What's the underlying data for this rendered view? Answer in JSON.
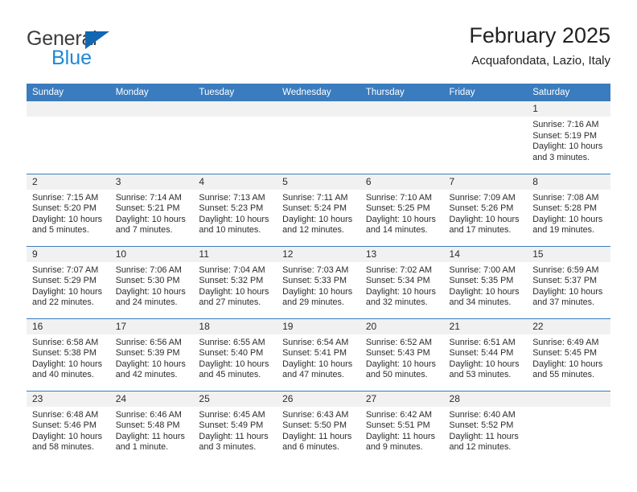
{
  "brand": {
    "line1": "General",
    "line2": "Blue",
    "triangle_color": "#1267b2"
  },
  "header": {
    "title": "February 2025",
    "subtitle": "Acquafondata, Lazio, Italy"
  },
  "theme": {
    "header_blue": "#3a7cbe",
    "daynum_band": "#f1f1f1",
    "text": "#2b2b2b"
  },
  "labels": {
    "sunrise_prefix": "Sunrise:",
    "sunset_prefix": "Sunset:",
    "daylight_prefix": "Daylight:"
  },
  "weekdays": [
    "Sunday",
    "Monday",
    "Tuesday",
    "Wednesday",
    "Thursday",
    "Friday",
    "Saturday"
  ],
  "weeks": [
    [
      {
        "day": "",
        "sunrise": "",
        "sunset": "",
        "daylight1": "",
        "daylight2": ""
      },
      {
        "day": "",
        "sunrise": "",
        "sunset": "",
        "daylight1": "",
        "daylight2": ""
      },
      {
        "day": "",
        "sunrise": "",
        "sunset": "",
        "daylight1": "",
        "daylight2": ""
      },
      {
        "day": "",
        "sunrise": "",
        "sunset": "",
        "daylight1": "",
        "daylight2": ""
      },
      {
        "day": "",
        "sunrise": "",
        "sunset": "",
        "daylight1": "",
        "daylight2": ""
      },
      {
        "day": "",
        "sunrise": "",
        "sunset": "",
        "daylight1": "",
        "daylight2": ""
      },
      {
        "day": "1",
        "sunrise": "Sunrise: 7:16 AM",
        "sunset": "Sunset: 5:19 PM",
        "daylight1": "Daylight: 10 hours",
        "daylight2": "and 3 minutes."
      }
    ],
    [
      {
        "day": "2",
        "sunrise": "Sunrise: 7:15 AM",
        "sunset": "Sunset: 5:20 PM",
        "daylight1": "Daylight: 10 hours",
        "daylight2": "and 5 minutes."
      },
      {
        "day": "3",
        "sunrise": "Sunrise: 7:14 AM",
        "sunset": "Sunset: 5:21 PM",
        "daylight1": "Daylight: 10 hours",
        "daylight2": "and 7 minutes."
      },
      {
        "day": "4",
        "sunrise": "Sunrise: 7:13 AM",
        "sunset": "Sunset: 5:23 PM",
        "daylight1": "Daylight: 10 hours",
        "daylight2": "and 10 minutes."
      },
      {
        "day": "5",
        "sunrise": "Sunrise: 7:11 AM",
        "sunset": "Sunset: 5:24 PM",
        "daylight1": "Daylight: 10 hours",
        "daylight2": "and 12 minutes."
      },
      {
        "day": "6",
        "sunrise": "Sunrise: 7:10 AM",
        "sunset": "Sunset: 5:25 PM",
        "daylight1": "Daylight: 10 hours",
        "daylight2": "and 14 minutes."
      },
      {
        "day": "7",
        "sunrise": "Sunrise: 7:09 AM",
        "sunset": "Sunset: 5:26 PM",
        "daylight1": "Daylight: 10 hours",
        "daylight2": "and 17 minutes."
      },
      {
        "day": "8",
        "sunrise": "Sunrise: 7:08 AM",
        "sunset": "Sunset: 5:28 PM",
        "daylight1": "Daylight: 10 hours",
        "daylight2": "and 19 minutes."
      }
    ],
    [
      {
        "day": "9",
        "sunrise": "Sunrise: 7:07 AM",
        "sunset": "Sunset: 5:29 PM",
        "daylight1": "Daylight: 10 hours",
        "daylight2": "and 22 minutes."
      },
      {
        "day": "10",
        "sunrise": "Sunrise: 7:06 AM",
        "sunset": "Sunset: 5:30 PM",
        "daylight1": "Daylight: 10 hours",
        "daylight2": "and 24 minutes."
      },
      {
        "day": "11",
        "sunrise": "Sunrise: 7:04 AM",
        "sunset": "Sunset: 5:32 PM",
        "daylight1": "Daylight: 10 hours",
        "daylight2": "and 27 minutes."
      },
      {
        "day": "12",
        "sunrise": "Sunrise: 7:03 AM",
        "sunset": "Sunset: 5:33 PM",
        "daylight1": "Daylight: 10 hours",
        "daylight2": "and 29 minutes."
      },
      {
        "day": "13",
        "sunrise": "Sunrise: 7:02 AM",
        "sunset": "Sunset: 5:34 PM",
        "daylight1": "Daylight: 10 hours",
        "daylight2": "and 32 minutes."
      },
      {
        "day": "14",
        "sunrise": "Sunrise: 7:00 AM",
        "sunset": "Sunset: 5:35 PM",
        "daylight1": "Daylight: 10 hours",
        "daylight2": "and 34 minutes."
      },
      {
        "day": "15",
        "sunrise": "Sunrise: 6:59 AM",
        "sunset": "Sunset: 5:37 PM",
        "daylight1": "Daylight: 10 hours",
        "daylight2": "and 37 minutes."
      }
    ],
    [
      {
        "day": "16",
        "sunrise": "Sunrise: 6:58 AM",
        "sunset": "Sunset: 5:38 PM",
        "daylight1": "Daylight: 10 hours",
        "daylight2": "and 40 minutes."
      },
      {
        "day": "17",
        "sunrise": "Sunrise: 6:56 AM",
        "sunset": "Sunset: 5:39 PM",
        "daylight1": "Daylight: 10 hours",
        "daylight2": "and 42 minutes."
      },
      {
        "day": "18",
        "sunrise": "Sunrise: 6:55 AM",
        "sunset": "Sunset: 5:40 PM",
        "daylight1": "Daylight: 10 hours",
        "daylight2": "and 45 minutes."
      },
      {
        "day": "19",
        "sunrise": "Sunrise: 6:54 AM",
        "sunset": "Sunset: 5:41 PM",
        "daylight1": "Daylight: 10 hours",
        "daylight2": "and 47 minutes."
      },
      {
        "day": "20",
        "sunrise": "Sunrise: 6:52 AM",
        "sunset": "Sunset: 5:43 PM",
        "daylight1": "Daylight: 10 hours",
        "daylight2": "and 50 minutes."
      },
      {
        "day": "21",
        "sunrise": "Sunrise: 6:51 AM",
        "sunset": "Sunset: 5:44 PM",
        "daylight1": "Daylight: 10 hours",
        "daylight2": "and 53 minutes."
      },
      {
        "day": "22",
        "sunrise": "Sunrise: 6:49 AM",
        "sunset": "Sunset: 5:45 PM",
        "daylight1": "Daylight: 10 hours",
        "daylight2": "and 55 minutes."
      }
    ],
    [
      {
        "day": "23",
        "sunrise": "Sunrise: 6:48 AM",
        "sunset": "Sunset: 5:46 PM",
        "daylight1": "Daylight: 10 hours",
        "daylight2": "and 58 minutes."
      },
      {
        "day": "24",
        "sunrise": "Sunrise: 6:46 AM",
        "sunset": "Sunset: 5:48 PM",
        "daylight1": "Daylight: 11 hours",
        "daylight2": "and 1 minute."
      },
      {
        "day": "25",
        "sunrise": "Sunrise: 6:45 AM",
        "sunset": "Sunset: 5:49 PM",
        "daylight1": "Daylight: 11 hours",
        "daylight2": "and 3 minutes."
      },
      {
        "day": "26",
        "sunrise": "Sunrise: 6:43 AM",
        "sunset": "Sunset: 5:50 PM",
        "daylight1": "Daylight: 11 hours",
        "daylight2": "and 6 minutes."
      },
      {
        "day": "27",
        "sunrise": "Sunrise: 6:42 AM",
        "sunset": "Sunset: 5:51 PM",
        "daylight1": "Daylight: 11 hours",
        "daylight2": "and 9 minutes."
      },
      {
        "day": "28",
        "sunrise": "Sunrise: 6:40 AM",
        "sunset": "Sunset: 5:52 PM",
        "daylight1": "Daylight: 11 hours",
        "daylight2": "and 12 minutes."
      },
      {
        "day": "",
        "sunrise": "",
        "sunset": "",
        "daylight1": "",
        "daylight2": ""
      }
    ]
  ]
}
